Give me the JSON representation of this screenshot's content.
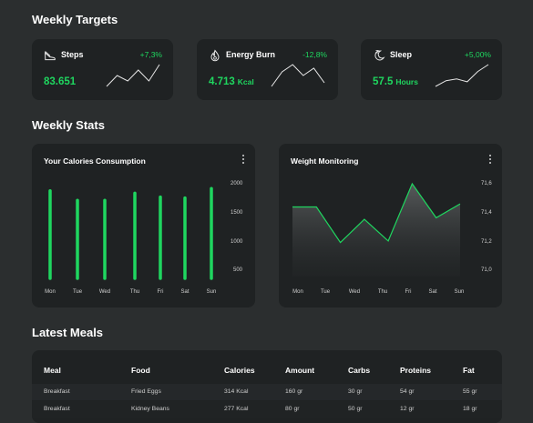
{
  "sections": {
    "weekly_targets": "Weekly Targets",
    "weekly_stats": "Weekly Stats",
    "latest_meals": "Latest Meals"
  },
  "targets": [
    {
      "name": "Steps",
      "icon": "shoe-icon",
      "change": "+7,3%",
      "change_color": "#1fd65f",
      "value": "83.651",
      "unit": "",
      "trend": [
        1,
        3,
        2,
        4,
        2,
        5
      ]
    },
    {
      "name": "Energy Burn",
      "icon": "flame-icon",
      "change": "-12,8%",
      "change_color": "#1fd65f",
      "value": "4.713",
      "unit": "Kcal",
      "trend": [
        1,
        3,
        4,
        2.5,
        3.5,
        1.5
      ]
    },
    {
      "name": "Sleep",
      "icon": "moon-icon",
      "change": "+5,00%",
      "change_color": "#1fd65f",
      "value": "57.5",
      "unit": "Hours",
      "trend": [
        1,
        2,
        2.3,
        1.8,
        3.6,
        4.8
      ]
    }
  ],
  "chart_data": [
    {
      "type": "bar",
      "title": "Your Calories Consumption",
      "categories": [
        "Mon",
        "Tue",
        "Wed",
        "Thu",
        "Fri",
        "Sat",
        "Sun"
      ],
      "values": [
        1850,
        1650,
        1650,
        1800,
        1720,
        1700,
        1900
      ],
      "yticks": [
        "2000",
        "1500",
        "1000",
        "500"
      ],
      "ylim": [
        0,
        2000
      ],
      "color": "#1fd65f"
    },
    {
      "type": "area",
      "title": "Weight Monitoring",
      "categories": [
        "Mon",
        "Tue",
        "Wed",
        "Thu",
        "Fri",
        "Sat",
        "Sun"
      ],
      "values": [
        71.45,
        71.45,
        71.22,
        71.37,
        71.23,
        71.6,
        71.38,
        71.47
      ],
      "yticks": [
        "71,6",
        "71,4",
        "71,2",
        "71,0"
      ],
      "ylim": [
        71.0,
        71.6
      ],
      "color": "#1fd65f"
    }
  ],
  "meals": {
    "headers": [
      "Meal",
      "Food",
      "Calories",
      "Amount",
      "Carbs",
      "Proteins",
      "Fat"
    ],
    "rows": [
      [
        "Breakfast",
        "Fried Eggs",
        "314 Kcal",
        "160 gr",
        "30 gr",
        "54 gr",
        "55 gr"
      ],
      [
        "Breakfast",
        "Kidney Beans",
        "277 Kcal",
        "80 gr",
        "50 gr",
        "12 gr",
        "18 gr"
      ]
    ]
  },
  "colors": {
    "accent": "#1fd65f",
    "background": "#2b2e2f",
    "card": "#1f2223"
  }
}
